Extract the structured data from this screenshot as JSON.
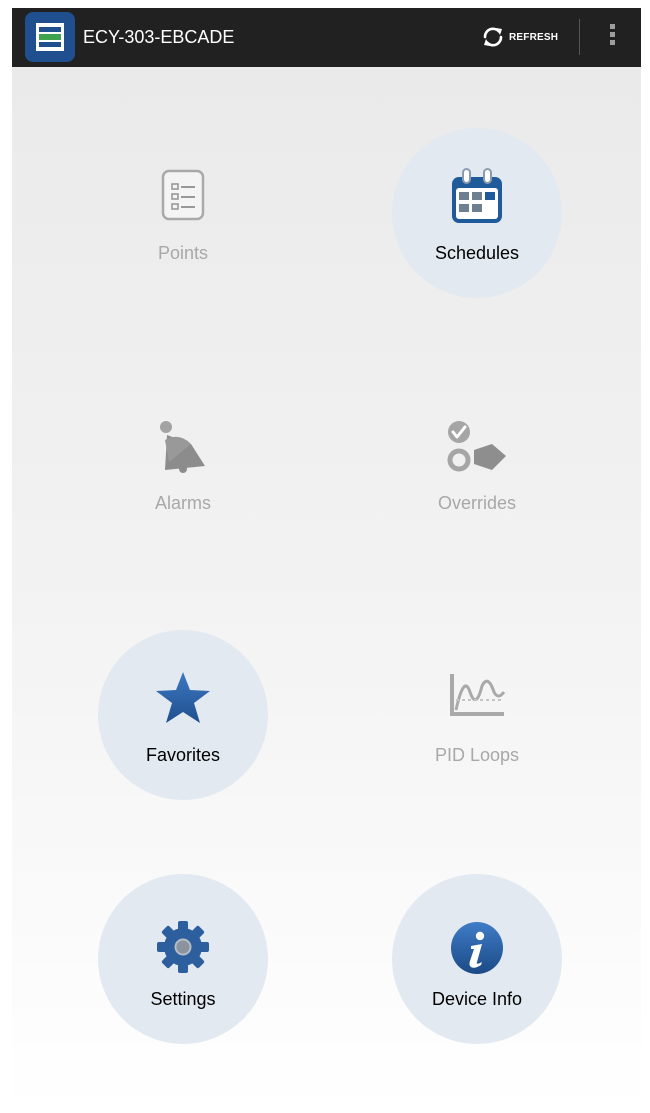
{
  "app": {
    "title": "ECY-303-EBCADE",
    "refresh_label": "REFRESH"
  },
  "tiles": [
    {
      "label": "Points",
      "icon": "checklist-icon",
      "enabled": false
    },
    {
      "label": "Schedules",
      "icon": "calendar-icon",
      "enabled": true
    },
    {
      "label": "Alarms",
      "icon": "bell-icon",
      "enabled": false
    },
    {
      "label": "Overrides",
      "icon": "override-hand-icon",
      "enabled": false
    },
    {
      "label": "Favorites",
      "icon": "star-icon",
      "enabled": true
    },
    {
      "label": "PID Loops",
      "icon": "pid-graph-icon",
      "enabled": false
    },
    {
      "label": "Settings",
      "icon": "gear-icon",
      "enabled": true
    },
    {
      "label": "Device Info",
      "icon": "info-icon",
      "enabled": true
    }
  ],
  "colors": {
    "topbar": "#212121",
    "brand": "#1f4f8e",
    "tile_highlight": "#e2e9f0",
    "disabled_text": "#a8a8a8"
  }
}
